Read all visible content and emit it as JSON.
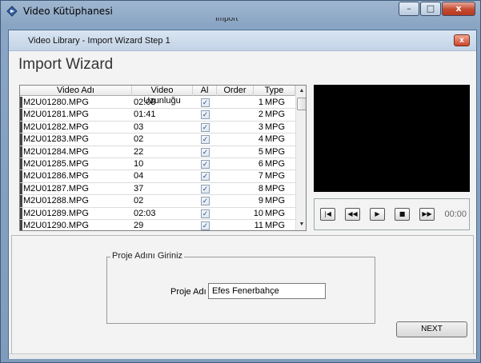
{
  "outer_window": {
    "title": "Video Kütüphanesi",
    "partial_tab_text": "Import",
    "minimize_glyph": "–",
    "maximize_glyph": "□",
    "close_glyph": "x"
  },
  "dialog": {
    "title": "Video Library - Import Wizard Step 1",
    "close_glyph": "x",
    "heading": "Import Wizard"
  },
  "grid": {
    "columns": [
      "Video Adı",
      "Video Uzunluğu",
      "Al",
      "Order",
      "Type"
    ],
    "rows": [
      {
        "name": "M2U01280.MPG",
        "duration": "02:08",
        "checked": true,
        "order": "1",
        "type": "MPG"
      },
      {
        "name": "M2U01281.MPG",
        "duration": "01:41",
        "checked": true,
        "order": "2",
        "type": "MPG"
      },
      {
        "name": "M2U01282.MPG",
        "duration": "03",
        "checked": true,
        "order": "3",
        "type": "MPG"
      },
      {
        "name": "M2U01283.MPG",
        "duration": "02",
        "checked": true,
        "order": "4",
        "type": "MPG"
      },
      {
        "name": "M2U01284.MPG",
        "duration": "22",
        "checked": true,
        "order": "5",
        "type": "MPG"
      },
      {
        "name": "M2U01285.MPG",
        "duration": "10",
        "checked": true,
        "order": "6",
        "type": "MPG"
      },
      {
        "name": "M2U01286.MPG",
        "duration": "04",
        "checked": true,
        "order": "7",
        "type": "MPG"
      },
      {
        "name": "M2U01287.MPG",
        "duration": "37",
        "checked": true,
        "order": "8",
        "type": "MPG"
      },
      {
        "name": "M2U01288.MPG",
        "duration": "02",
        "checked": true,
        "order": "9",
        "type": "MPG"
      },
      {
        "name": "M2U01289.MPG",
        "duration": "02:03",
        "checked": true,
        "order": "10",
        "type": "MPG"
      },
      {
        "name": "M2U01290.MPG",
        "duration": "29",
        "checked": true,
        "order": "11",
        "type": "MPG"
      }
    ],
    "check_glyph": "✓"
  },
  "player": {
    "controls": [
      {
        "icon": "skip-to-start-icon",
        "glyph": "|◀"
      },
      {
        "icon": "rewind-icon",
        "glyph": "◀◀"
      },
      {
        "icon": "play-icon",
        "glyph": "▶"
      },
      {
        "icon": "stop-icon",
        "glyph": "■"
      },
      {
        "icon": "fast-forward-icon",
        "glyph": "▶▶"
      }
    ],
    "time": "00:00"
  },
  "project": {
    "group_label": "Proje Adını Giriniz",
    "name_label": "Proje Adı",
    "name_value": "Efes Fenerbahçe"
  },
  "buttons": {
    "next_label": "NEXT"
  },
  "colors": {
    "video_background": "#000000",
    "close_red": "#c6492f"
  }
}
